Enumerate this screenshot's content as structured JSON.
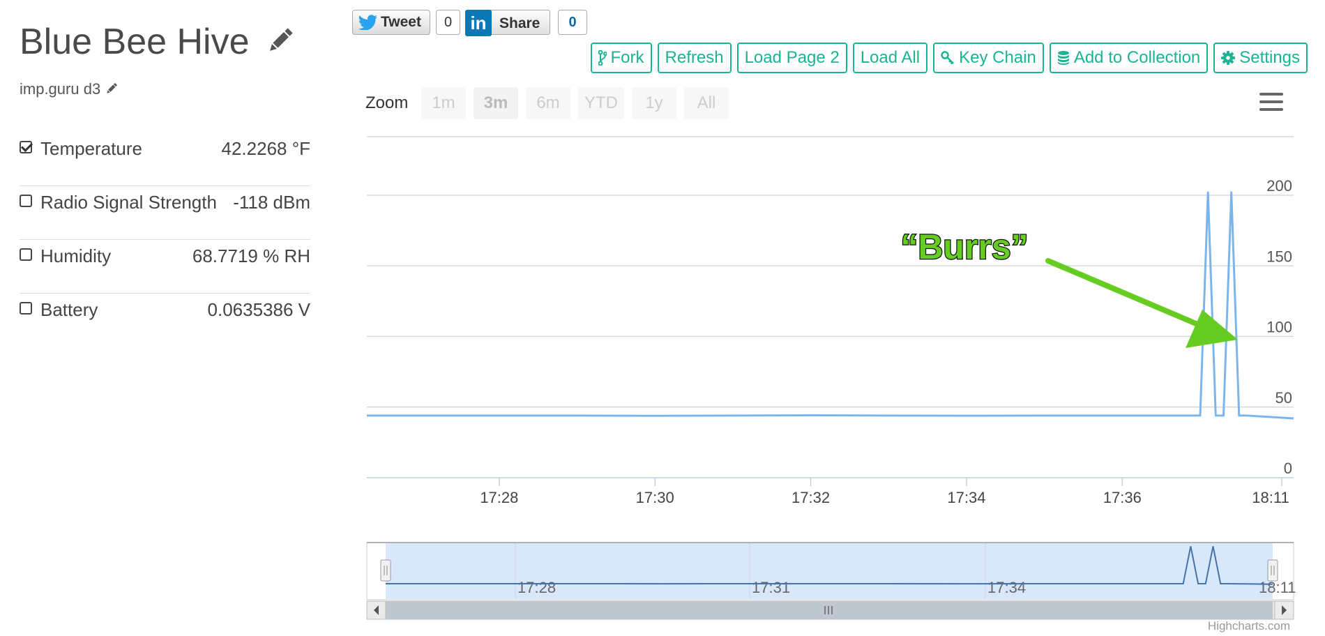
{
  "device": {
    "title": "Blue Bee Hive",
    "subtitle": "imp.guru d3",
    "sensors": [
      {
        "label": "Temperature",
        "value": "42.2268 °F",
        "checked": true
      },
      {
        "label": "Radio Signal Strength",
        "value": "-118 dBm",
        "checked": false
      },
      {
        "label": "Humidity",
        "value": "68.7719 % RH",
        "checked": false
      },
      {
        "label": "Battery",
        "value": "0.0635386 V",
        "checked": false
      }
    ]
  },
  "social": {
    "tweet_label": "Tweet",
    "tweet_count": "0",
    "share_label": "Share",
    "share_count": "0",
    "linkedin_logo": "in"
  },
  "toolbar": {
    "fork": "Fork",
    "refresh": "Refresh",
    "load_page_2": "Load Page 2",
    "load_all": "Load All",
    "key_chain": "Key Chain",
    "add_to_collection": "Add to Collection",
    "settings": "Settings"
  },
  "zoom": {
    "label": "Zoom",
    "options": [
      "1m",
      "3m",
      "6m",
      "YTD",
      "1y",
      "All"
    ],
    "selected": "3m"
  },
  "annotation": {
    "text": "“Burrs”",
    "color": "#66cc22"
  },
  "credits": "Highcharts.com",
  "chart_data": {
    "type": "line",
    "title": "",
    "xlabel": "",
    "ylabel": "",
    "ylim": [
      0,
      200
    ],
    "yticks": [
      "0",
      "50",
      "100",
      "150",
      "200"
    ],
    "xticks": [
      "17:28",
      "17:30",
      "17:32",
      "17:34",
      "17:36",
      "18:11"
    ],
    "navigator_xticks": [
      "17:28",
      "17:31",
      "17:34",
      "18:11"
    ],
    "grid": true,
    "line_color": "#7cb5ec",
    "series": [
      {
        "x": [
          "17:26.3",
          "17:27",
          "17:28",
          "17:29",
          "17:30",
          "17:31",
          "17:32",
          "17:33",
          "17:34",
          "17:35",
          "17:36",
          "17:36.9",
          "17:37.0",
          "17:37.1",
          "17:37.2",
          "17:37.3",
          "17:37.4",
          "17:37.5",
          "17:37.6",
          "18:11"
        ],
        "values": [
          44,
          44,
          44,
          44,
          43.8,
          44,
          44.2,
          44,
          43.9,
          44,
          44,
          44,
          44,
          202,
          44,
          44,
          202,
          44,
          44,
          42
        ]
      }
    ]
  }
}
